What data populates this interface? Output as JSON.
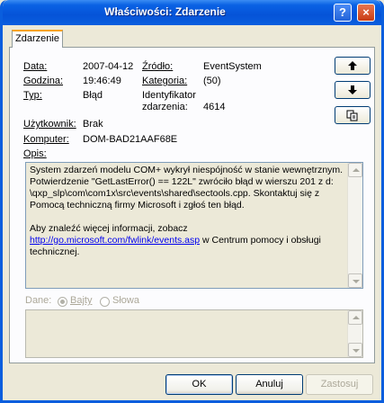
{
  "window": {
    "title": "Właściwości: Zdarzenie",
    "help_glyph": "?",
    "close_glyph": "×"
  },
  "tab": {
    "label": "Zdarzenie"
  },
  "fields": {
    "date_label": "Data:",
    "date_value": "2007-04-12",
    "time_label": "Godzina:",
    "time_value": "19:46:49",
    "type_label": "Typ:",
    "type_value": "Błąd",
    "source_label": "Źródło:",
    "source_value": "EventSystem",
    "category_label": "Kategoria:",
    "category_value": "(50)",
    "event_id_label_1": "Identyfikator",
    "event_id_label_2": "zdarzenia:",
    "event_id_value": "4614",
    "user_label": "Użytkownik:",
    "user_value": "Brak",
    "computer_label": "Komputer:",
    "computer_value": "DOM-BAD21AAF68E",
    "description_label": "Opis:"
  },
  "description": {
    "line1": "System zdarzeń modelu COM+ wykrył niespójność w stanie wewnętrznym.",
    "line2": "Potwierdzenie \"GetLastError() == 122L\" zwróciło błąd w wierszu 201 z d:",
    "line3": "\\qxp_slp\\com\\com1x\\src\\events\\shared\\sectools.cpp. Skontaktuj się z",
    "line4": "Pomocą techniczną firmy Microsoft i zgłoś ten błąd.",
    "line5": "Aby znaleźć więcej informacji, zobacz",
    "link": "http://go.microsoft.com/fwlink/events.asp",
    "line6_tail": " w Centrum pomocy i obsługi",
    "line7": "technicznej."
  },
  "data_section": {
    "label": "Dane:",
    "bytes_label": "Bajty",
    "words_label": "Słowa",
    "selected": "Bajty"
  },
  "buttons": {
    "ok": "OK",
    "cancel": "Anuluj",
    "apply": "Zastosuj"
  },
  "icons": {
    "prev": "arrow-up-icon",
    "next": "arrow-down-icon",
    "copy": "copy-icon"
  }
}
